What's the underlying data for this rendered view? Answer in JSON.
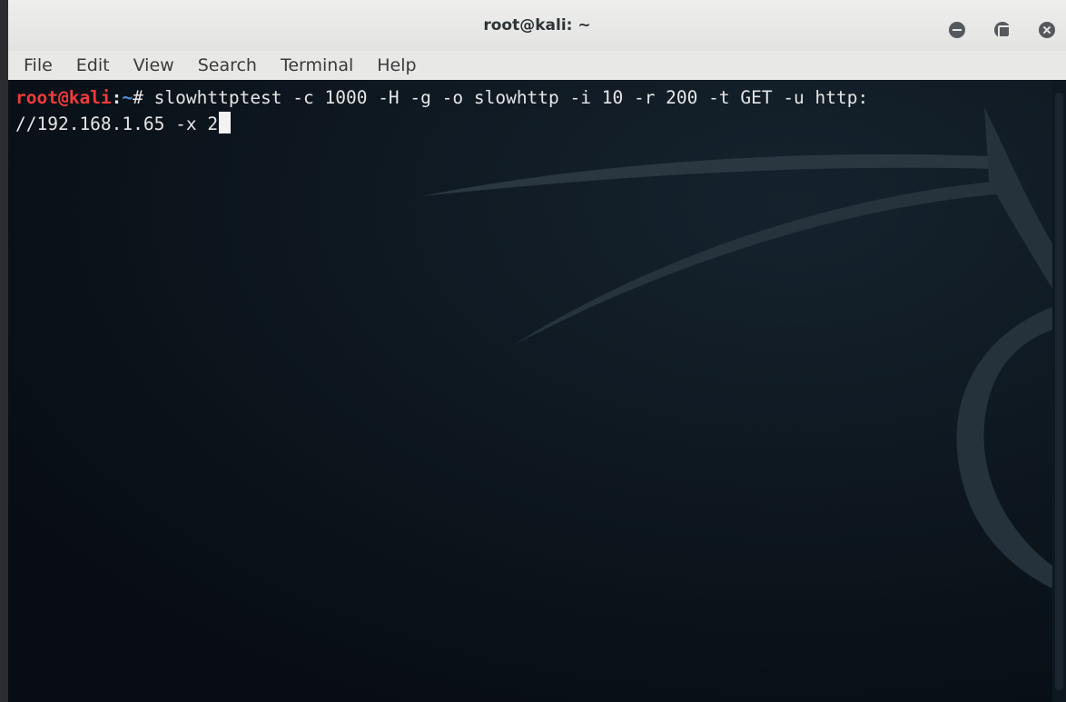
{
  "window": {
    "title": "root@kali: ~"
  },
  "menubar": {
    "items": [
      "File",
      "Edit",
      "View",
      "Search",
      "Terminal",
      "Help"
    ]
  },
  "terminal": {
    "prompt_user": "root@kali",
    "prompt_sep": ":",
    "prompt_dir": "~",
    "prompt_symbol": "# ",
    "command_line1": "slowhttptest -c 1000 -H -g -o slowhttp -i 10 -r 200 -t GET -u http:",
    "command_line2": "//192.168.1.65 -x 2"
  },
  "colors": {
    "terminal_bg": "#0b141c",
    "prompt_user": "#ef3b3b",
    "prompt_dir": "#4f8fdb",
    "text": "#e6e6e6"
  },
  "icons": {
    "minimize": "minimize-icon",
    "maximize": "maximize-icon",
    "close": "close-icon"
  }
}
